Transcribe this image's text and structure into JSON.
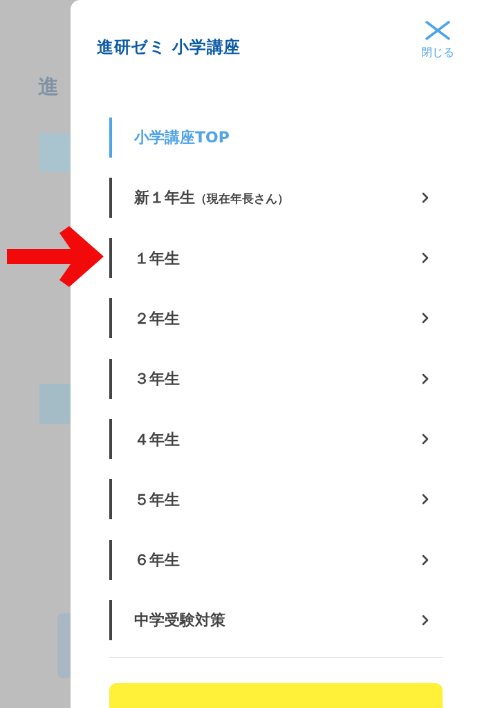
{
  "background_page": {
    "texts": [
      "進"
    ]
  },
  "drawer": {
    "logo": "進研ゼミ 小学講座",
    "close": {
      "label": "閉じる"
    },
    "menu": [
      {
        "label": "小学講座TOP",
        "selected": true,
        "chevron": false
      },
      {
        "label": "新１年生",
        "note": "（現在年長さん）",
        "selected": false,
        "chevron": true
      },
      {
        "label": "１年生",
        "selected": false,
        "chevron": true
      },
      {
        "label": "２年生",
        "selected": false,
        "chevron": true
      },
      {
        "label": "３年生",
        "selected": false,
        "chevron": true
      },
      {
        "label": "４年生",
        "selected": false,
        "chevron": true
      },
      {
        "label": "５年生",
        "selected": false,
        "chevron": true
      },
      {
        "label": "６年生",
        "selected": false,
        "chevron": true
      },
      {
        "label": "中学受験対策",
        "selected": false,
        "chevron": true
      }
    ]
  },
  "annotation": {
    "kind": "arrow"
  }
}
